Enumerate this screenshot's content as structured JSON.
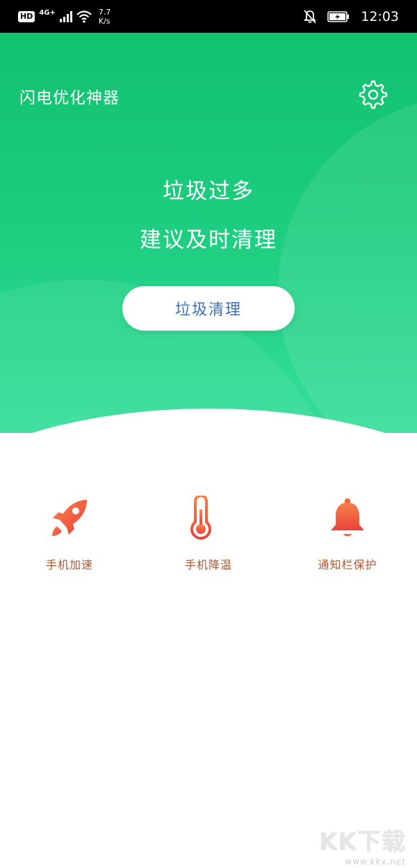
{
  "status_bar": {
    "hd": "HD",
    "network": "4G+",
    "speed_value": "7.7",
    "speed_unit": "K/s",
    "time": "12:03"
  },
  "header": {
    "title": "闪电优化神器",
    "settings_icon": "gear-icon"
  },
  "hero": {
    "line1": "垃圾过多",
    "line2": "建议及时清理",
    "button_label": "垃圾清理"
  },
  "features": [
    {
      "label": "手机加速",
      "icon": "rocket-icon"
    },
    {
      "label": "手机降温",
      "icon": "thermometer-icon"
    },
    {
      "label": "通知栏保护",
      "icon": "bell-icon"
    }
  ],
  "watermark": {
    "logo": "KK下载",
    "url": "www.kkx.net"
  },
  "colors": {
    "brand_green": "#1fcf82",
    "button_text": "#3b6fb4",
    "feature_text": "#b0562d",
    "icon_gradient_start": "#f9824a",
    "icon_gradient_end": "#e9423b"
  }
}
